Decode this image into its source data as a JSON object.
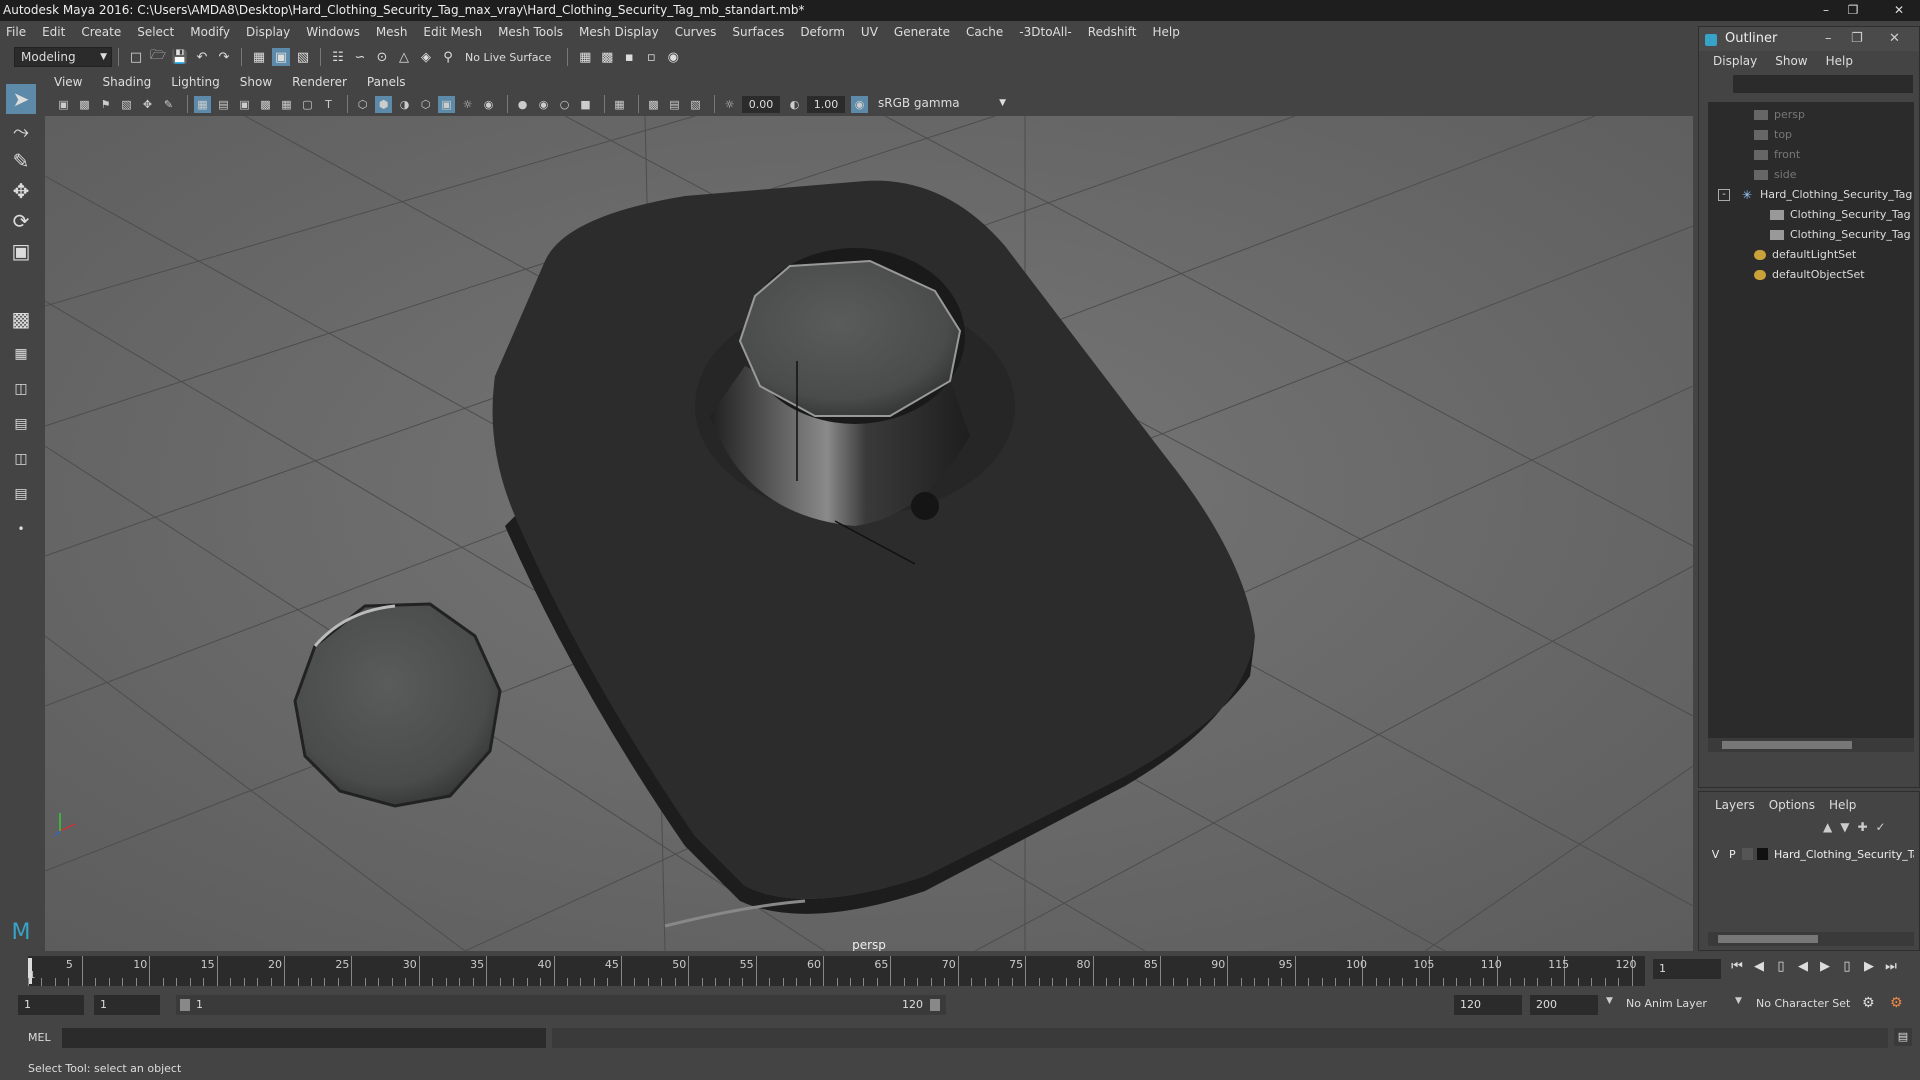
{
  "window": {
    "title": "Autodesk Maya 2016: C:\\Users\\AMDA8\\Desktop\\Hard_Clothing_Security_Tag_max_vray\\Hard_Clothing_Security_Tag_mb_standart.mb*"
  },
  "menubar": [
    "File",
    "Edit",
    "Create",
    "Select",
    "Modify",
    "Display",
    "Windows",
    "Mesh",
    "Edit Mesh",
    "Mesh Tools",
    "Mesh Display",
    "Curves",
    "Surfaces",
    "Deform",
    "UV",
    "Generate",
    "Cache",
    "-3DtoAll-",
    "Redshift",
    "Help"
  ],
  "shelf": {
    "mode": "Modeling",
    "live_surface": "No Live Surface"
  },
  "viewport": {
    "menu": [
      "View",
      "Shading",
      "Lighting",
      "Show",
      "Renderer",
      "Panels"
    ],
    "exposure": "0.00",
    "gamma": "1.00",
    "color_space": "sRGB gamma",
    "camera_label": "persp"
  },
  "outliner": {
    "title": "Outliner",
    "menu": [
      "Display",
      "Show",
      "Help"
    ],
    "items": [
      {
        "label": "persp",
        "type": "camera"
      },
      {
        "label": "top",
        "type": "camera"
      },
      {
        "label": "front",
        "type": "camera"
      },
      {
        "label": "side",
        "type": "camera"
      },
      {
        "label": "Hard_Clothing_Security_Tag",
        "type": "group"
      },
      {
        "label": "Clothing_Security_Tag",
        "type": "mesh"
      },
      {
        "label": "Clothing_Security_Tag",
        "type": "mesh"
      },
      {
        "label": "defaultLightSet",
        "type": "set"
      },
      {
        "label": "defaultObjectSet",
        "type": "set"
      }
    ]
  },
  "layers": {
    "menu": [
      "Layers",
      "Options",
      "Help"
    ],
    "row": {
      "v": "V",
      "p": "P",
      "name": "Hard_Clothing_Security_Tag"
    }
  },
  "timeline": {
    "ticks": [
      "5",
      "10",
      "15",
      "20",
      "25",
      "30",
      "35",
      "40",
      "45",
      "50",
      "55",
      "60",
      "65",
      "70",
      "75",
      "80",
      "85",
      "90",
      "95",
      "100",
      "105",
      "110",
      "115",
      "120"
    ],
    "current_frame_marker": "1",
    "current_frame": "1"
  },
  "range": {
    "start": "1",
    "anim_start": "1",
    "slider_start": "1",
    "slider_end": "120",
    "anim_end": "120",
    "end": "200",
    "anim_layer": "No Anim Layer",
    "char_set": "No Character Set"
  },
  "cmdline": {
    "label": "MEL"
  },
  "status": {
    "text": "Select Tool: select an object"
  }
}
